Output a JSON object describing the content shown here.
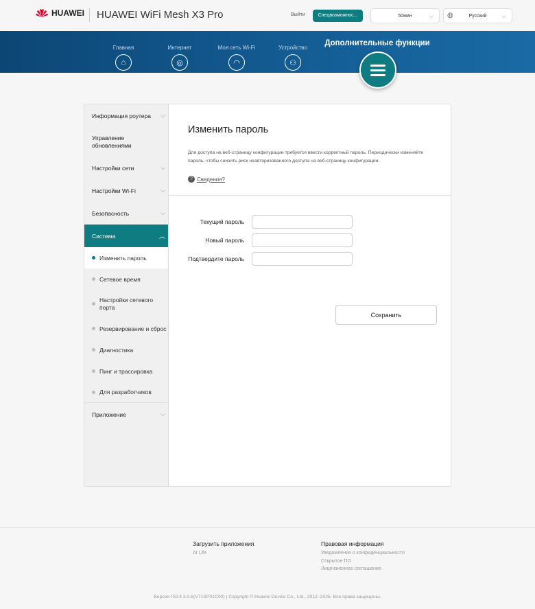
{
  "header": {
    "brand": "HUAWEI",
    "product": "HUAWEI WiFi Mesh X3 Pro",
    "logout": "Выйти",
    "accessibility": "Спецвозможнос...",
    "timeout": "50мин",
    "language": "Русский"
  },
  "nav": {
    "items": [
      {
        "label": "Главная",
        "icon": "home-icon"
      },
      {
        "label": "Интернет",
        "icon": "globe-icon"
      },
      {
        "label": "Моя сеть Wi-Fi",
        "icon": "wifi-icon"
      },
      {
        "label": "Устройство",
        "icon": "user-icon"
      }
    ],
    "active": "Дополнительные функции"
  },
  "sidebar": {
    "items": [
      "Информация роутера",
      "Управление обновлениями",
      "Настройки сети",
      "Настройки Wi-Fi",
      "Безопасность",
      "Система"
    ],
    "sub": [
      "Изменить пароль",
      "Сетевое время",
      "Настройки сетевого порта",
      "Резервирование и сброс",
      "Диагностика",
      "Пинг и трассировка",
      "Для разработчиков"
    ],
    "last": "Приложение"
  },
  "main": {
    "title": "Изменить пароль",
    "description": "Для доступа на веб-страницу конфигурации требуется ввести корректный пароль. Периодически изменяйте пароль, чтобы снизить риск неавторизованного доступа на веб-страницу конфигурации.",
    "help": "Сведения?",
    "fields": {
      "current": "Текущий пароль",
      "new": "Новый пароль",
      "confirm": "Подтвердите пароль"
    },
    "save": "Сохранить"
  },
  "footer": {
    "apps_title": "Загрузить приложения",
    "apps": [
      "AI Life"
    ],
    "legal_title": "Правовая информация",
    "legal": [
      "Уведомление о конфиденциальности",
      "Открытое ПО",
      "Лицензионное соглашение"
    ],
    "version": "Версия ПО:4.3.0.6(V71SP01C00) | Copyright © Huawei Device Co., Ltd., 2012–2025. Все права защищены."
  },
  "colors": {
    "accent": "#0e7c80",
    "nav": "#0c4675"
  }
}
